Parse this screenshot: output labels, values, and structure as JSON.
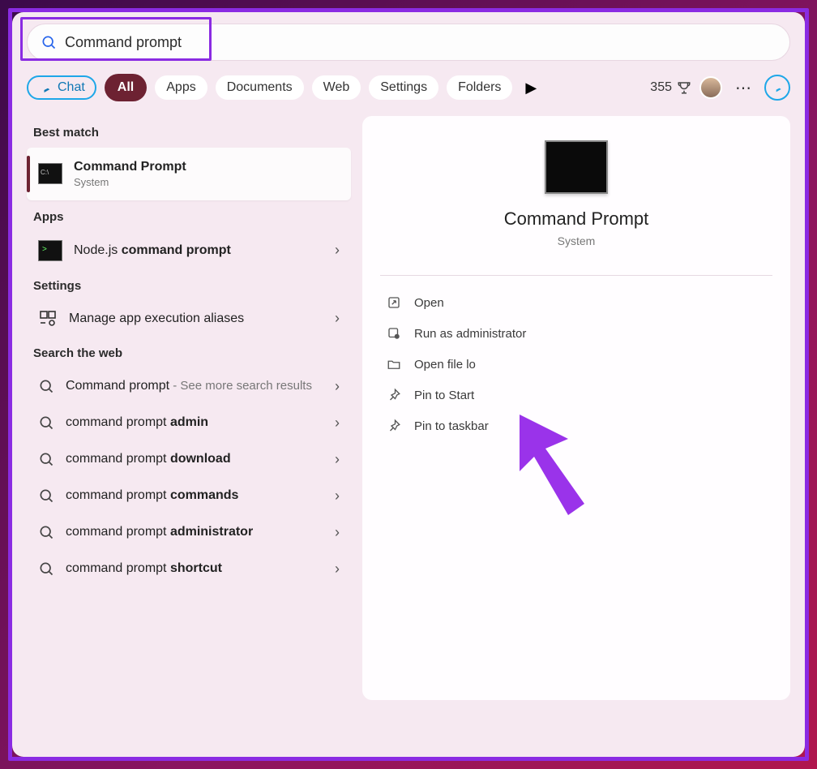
{
  "search": {
    "value": "Command prompt"
  },
  "filters": {
    "chat": "Chat",
    "all": "All",
    "apps": "Apps",
    "documents": "Documents",
    "web": "Web",
    "settings": "Settings",
    "folders": "Folders"
  },
  "rewards": {
    "points": "355"
  },
  "sections": {
    "best_match": "Best match",
    "apps": "Apps",
    "settings": "Settings",
    "web": "Search the web"
  },
  "best": {
    "title": "Command Prompt",
    "sub": "System"
  },
  "apps_results": [
    {
      "prefix": "Node.js ",
      "bold": "command prompt"
    }
  ],
  "settings_results": [
    {
      "label": "Manage app execution aliases"
    }
  ],
  "web_results": [
    {
      "prefix": "Command prompt",
      "hint": " - See more search results"
    },
    {
      "prefix": "command prompt ",
      "bold": "admin"
    },
    {
      "prefix": "command prompt ",
      "bold": "download"
    },
    {
      "prefix": "command prompt ",
      "bold": "commands"
    },
    {
      "prefix": "command prompt ",
      "bold": "administrator"
    },
    {
      "prefix": "command prompt ",
      "bold": "shortcut"
    }
  ],
  "detail": {
    "title": "Command Prompt",
    "sub": "System",
    "actions": {
      "open": "Open",
      "admin": "Run as administrator",
      "file_loc": "Open file lo",
      "pin_start": "Pin to Start",
      "pin_taskbar": "Pin to taskbar"
    }
  }
}
